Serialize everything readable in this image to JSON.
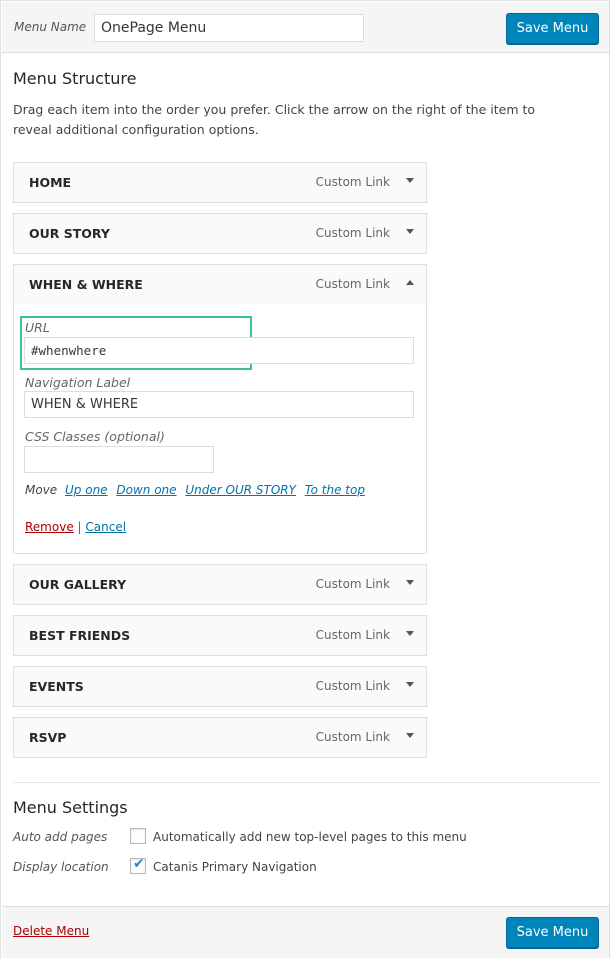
{
  "header": {
    "menu_name_label": "Menu Name",
    "menu_name_value": "OnePage Menu",
    "save_label": "Save Menu"
  },
  "structure": {
    "title": "Menu Structure",
    "instructions": "Drag each item into the order you prefer. Click the arrow on the right of the item to reveal additional configuration options."
  },
  "items": [
    {
      "title": "HOME",
      "type": "Custom Link",
      "expanded": false
    },
    {
      "title": "OUR STORY",
      "type": "Custom Link",
      "expanded": false
    },
    {
      "title": "WHEN & WHERE",
      "type": "Custom Link",
      "expanded": true
    },
    {
      "title": "OUR GALLERY",
      "type": "Custom Link",
      "expanded": false
    },
    {
      "title": "BEST FRIENDS",
      "type": "Custom Link",
      "expanded": false
    },
    {
      "title": "EVENTS",
      "type": "Custom Link",
      "expanded": false
    },
    {
      "title": "RSVP",
      "type": "Custom Link",
      "expanded": false
    }
  ],
  "item_settings": {
    "url_label": "URL",
    "url_value": "#whenwhere",
    "nav_label_label": "Navigation Label",
    "nav_label_value": "WHEN & WHERE",
    "css_label": "CSS Classes (optional)",
    "css_value": "",
    "move_label": "Move",
    "move_links": [
      "Up one",
      "Down one",
      "Under OUR STORY",
      "To the top"
    ],
    "remove_label": "Remove",
    "separator": "|",
    "cancel_label": "Cancel"
  },
  "settings": {
    "title": "Menu Settings",
    "auto_add_label": "Auto add pages",
    "auto_add_text": "Automatically add new top-level pages to this menu",
    "auto_add_checked": false,
    "display_location_label": "Display location",
    "display_location_text": "Catanis Primary Navigation",
    "display_location_checked": true
  },
  "footer": {
    "delete_label": "Delete Menu",
    "save_label": "Save Menu"
  },
  "colors": {
    "primary_button": "#0085ba",
    "link": "#0073aa",
    "danger": "#aa0000",
    "highlight": "#3dbf9e"
  }
}
